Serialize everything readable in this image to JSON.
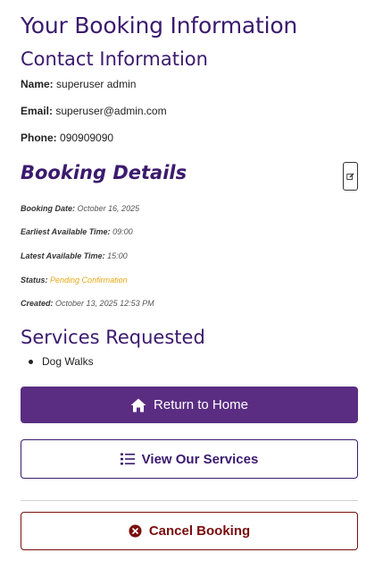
{
  "header": {
    "title": "Your Booking Information"
  },
  "contact": {
    "title": "Contact Information",
    "name_label": "Name:",
    "name_value": "superuser admin",
    "email_label": "Email:",
    "email_value": "superuser@admin.com",
    "phone_label": "Phone:",
    "phone_value": "090909090"
  },
  "details": {
    "title": "Booking Details",
    "booking_date_label": "Booking Date:",
    "booking_date_value": "October 16, 2025",
    "earliest_label": "Earliest Available Time:",
    "earliest_value": "09:00",
    "latest_label": "Latest Available Time:",
    "latest_value": "15:00",
    "status_label": "Status:",
    "status_value": "Pending Confirmation",
    "created_label": "Created:",
    "created_value": "October 13, 2025 12:53 PM"
  },
  "services": {
    "title": "Services Requested",
    "items": [
      "Dog Walks"
    ]
  },
  "actions": {
    "home_label": "Return to Home",
    "services_label": "View Our Services",
    "cancel_label": "Cancel Booking"
  },
  "colors": {
    "primary": "#5a2d82",
    "heading": "#3b1a6e",
    "status": "#e6a817",
    "danger": "#7a0d0d"
  },
  "icons": {
    "edit": "edit-icon",
    "home": "home-icon",
    "list": "list-icon",
    "cancel": "circle-x-icon"
  }
}
